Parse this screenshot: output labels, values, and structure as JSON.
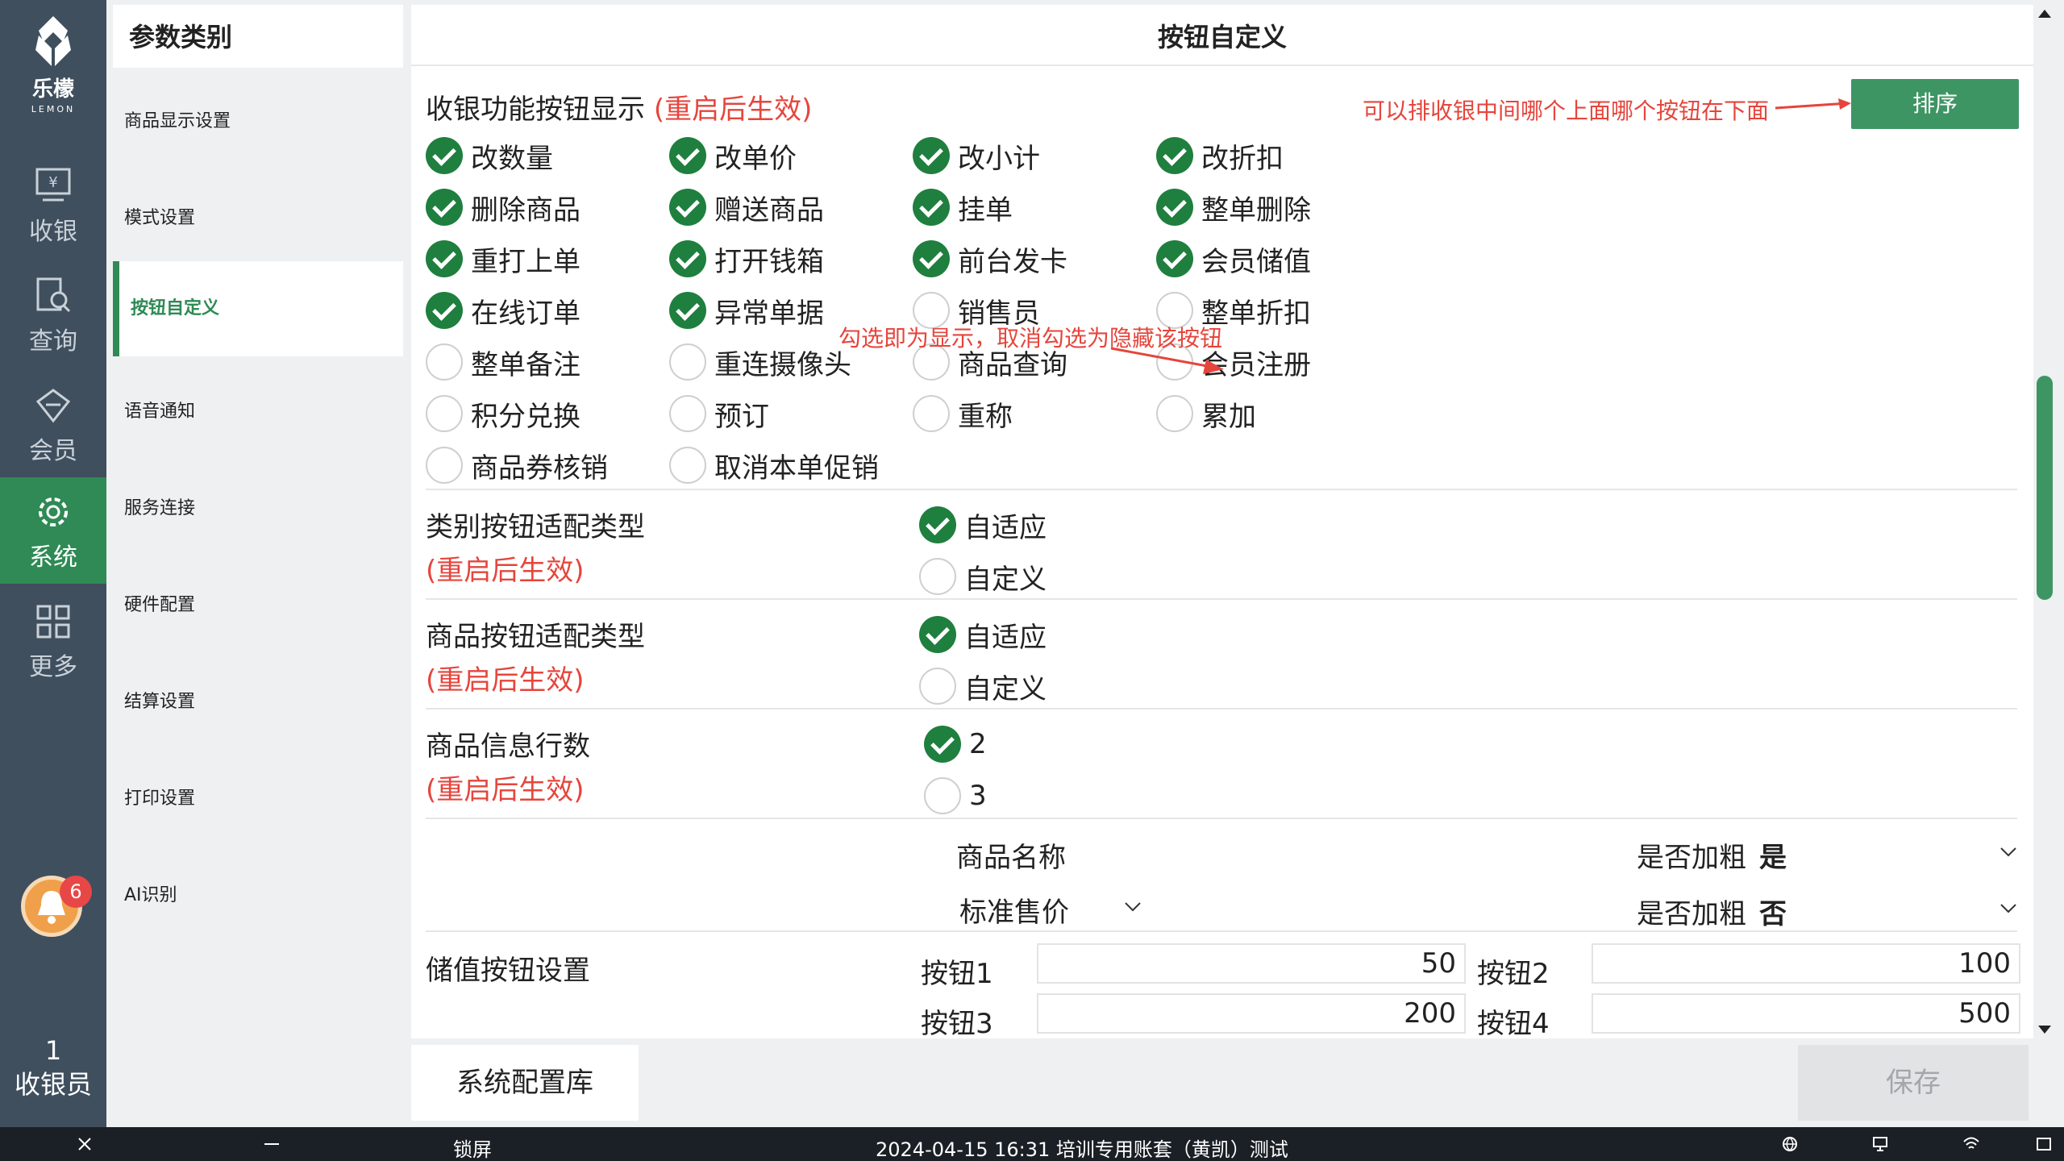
{
  "nav": {
    "brand": "乐檬",
    "brand_sub": "LEMON",
    "items": [
      {
        "label": "收银",
        "icon": "cashier-icon"
      },
      {
        "label": "查询",
        "icon": "query-icon"
      },
      {
        "label": "会员",
        "icon": "member-icon"
      },
      {
        "label": "系统",
        "icon": "gear-icon",
        "active": true
      },
      {
        "label": "更多",
        "icon": "grid-icon"
      }
    ],
    "notification_count": "6",
    "user_id": "1",
    "user_role": "收银员"
  },
  "categories": {
    "header": "参数类别",
    "items": [
      {
        "label": "商品显示设置"
      },
      {
        "label": "模式设置"
      },
      {
        "label": "按钮自定义",
        "active": true
      },
      {
        "label": "语音通知"
      },
      {
        "label": "服务连接"
      },
      {
        "label": "硬件配置"
      },
      {
        "label": "结算设置"
      },
      {
        "label": "打印设置"
      },
      {
        "label": "AI识别"
      }
    ]
  },
  "main": {
    "title": "按钮自定义",
    "section1": {
      "title": "收银功能按钮显示",
      "note": "(重启后生效)",
      "sort_button": "排序",
      "annotation_sort": "可以排收银中间哪个上面哪个按钮在下面",
      "annotation_check": "勾选即为显示，取消勾选为隐藏该按钮",
      "options": [
        {
          "label": "改数量",
          "checked": true
        },
        {
          "label": "改单价",
          "checked": true
        },
        {
          "label": "改小计",
          "checked": true
        },
        {
          "label": "改折扣",
          "checked": true
        },
        {
          "label": "删除商品",
          "checked": true
        },
        {
          "label": "赠送商品",
          "checked": true
        },
        {
          "label": "挂单",
          "checked": true
        },
        {
          "label": "整单删除",
          "checked": true
        },
        {
          "label": "重打上单",
          "checked": true
        },
        {
          "label": "打开钱箱",
          "checked": true
        },
        {
          "label": "前台发卡",
          "checked": true
        },
        {
          "label": "会员储值",
          "checked": true
        },
        {
          "label": "在线订单",
          "checked": true
        },
        {
          "label": "异常单据",
          "checked": true
        },
        {
          "label": "销售员",
          "checked": false
        },
        {
          "label": "整单折扣",
          "checked": false
        },
        {
          "label": "整单备注",
          "checked": false
        },
        {
          "label": "重连摄像头",
          "checked": false
        },
        {
          "label": "商品查询",
          "checked": false
        },
        {
          "label": "会员注册",
          "checked": false
        },
        {
          "label": "积分兑换",
          "checked": false
        },
        {
          "label": "预订",
          "checked": false
        },
        {
          "label": "重称",
          "checked": false
        },
        {
          "label": "累加",
          "checked": false
        },
        {
          "label": "商品券核销",
          "checked": false
        },
        {
          "label": "取消本单促销",
          "checked": false
        }
      ]
    },
    "section2": {
      "title": "类别按钮适配类型",
      "note": "(重启后生效)",
      "options": [
        {
          "label": "自适应",
          "checked": true
        },
        {
          "label": "自定义",
          "checked": false
        }
      ]
    },
    "section3": {
      "title": "商品按钮适配类型",
      "note": "(重启后生效)",
      "options": [
        {
          "label": "自适应",
          "checked": true
        },
        {
          "label": "自定义",
          "checked": false
        }
      ]
    },
    "section4": {
      "title": "商品信息行数",
      "note": "(重启后生效)",
      "options": [
        {
          "label": "2",
          "checked": true
        },
        {
          "label": "3",
          "checked": false
        }
      ]
    },
    "info_rows": {
      "row1_field": "商品名称",
      "row1_bold_label": "是否加粗",
      "row1_bold_value": "是",
      "row2_field": "标准售价",
      "row2_bold_label": "是否加粗",
      "row2_bold_value": "否"
    },
    "stored_value": {
      "title": "储值按钮设置",
      "buttons": [
        {
          "label": "按钮1",
          "value": "50"
        },
        {
          "label": "按钮2",
          "value": "100"
        },
        {
          "label": "按钮3",
          "value": "200"
        },
        {
          "label": "按钮4",
          "value": "500"
        }
      ]
    }
  },
  "footer": {
    "sys_config": "系统配置库",
    "save": "保存"
  },
  "taskbar": {
    "lock": "锁屏",
    "status": "2024-04-15 16:31 培训专用账套（黄凯）测试"
  },
  "colors": {
    "nav_bg": "#3f4f5e",
    "accent_green": "#2f8a55",
    "check_green": "#1f7f3e",
    "annotation_red": "#e5453c"
  }
}
